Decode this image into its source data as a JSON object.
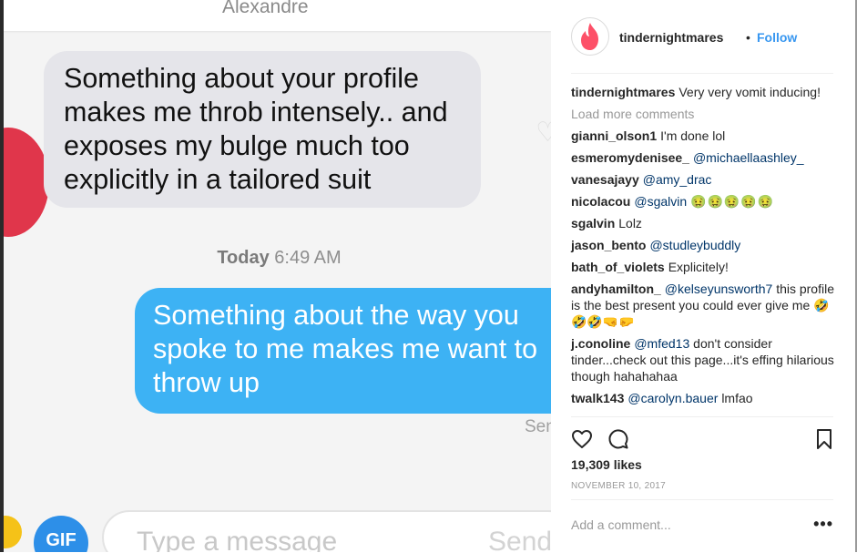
{
  "chat": {
    "contact_name": "Alexandre",
    "incoming_message": "Something about your profile makes me throb intensely.. and exposes my bulge much too explicitly in a tailored suit",
    "time_day": "Today",
    "time_clock": "6:49 AM",
    "outgoing_message": "Something about the way you spoke to me makes me want to throw up",
    "sent_label": "Sen",
    "gif_label": "GIF",
    "input_placeholder": "Type a message",
    "send_label": "Send"
  },
  "post": {
    "username": "tindernightmares",
    "separator": "•",
    "follow_label": "Follow",
    "caption_user": "tindernightmares",
    "caption_text": "Very very vomit inducing!",
    "load_more": "Load more comments",
    "comments": [
      {
        "user": "gianni_olson1",
        "mention": "",
        "text": "I'm done lol"
      },
      {
        "user": "esmeromydenisee_",
        "mention": "@michaellaashley_",
        "text": ""
      },
      {
        "user": "vanesajayy",
        "mention": "@amy_drac",
        "text": ""
      },
      {
        "user": "nicolacou",
        "mention": "@sgalvin",
        "text": "🤢🤢🤢🤢🤢"
      },
      {
        "user": "sgalvin",
        "mention": "",
        "text": "Lolz"
      },
      {
        "user": "jason_bento",
        "mention": "@studleybuddly",
        "text": ""
      },
      {
        "user": "bath_of_violets",
        "mention": "",
        "text": "Explicitely!"
      },
      {
        "user": "andyhamilton_",
        "mention": "@kelseyunsworth7",
        "text": "this profile is the best present you could ever give me 🤣🤣🤣🤜🤛"
      },
      {
        "user": "j.conoline",
        "mention": "@mfed13",
        "text": "don't consider tinder...check out this page...it's effing hilarious though hahahahaa"
      },
      {
        "user": "twalk143",
        "mention": "@carolyn.bauer",
        "text": "lmfao"
      }
    ],
    "likes": "19,309 likes",
    "date": "NOVEMBER 10, 2017",
    "add_comment_placeholder": "Add a comment...",
    "more_label": "•••",
    "brand_color": "#fd5068",
    "link_color": "#3897f0"
  }
}
